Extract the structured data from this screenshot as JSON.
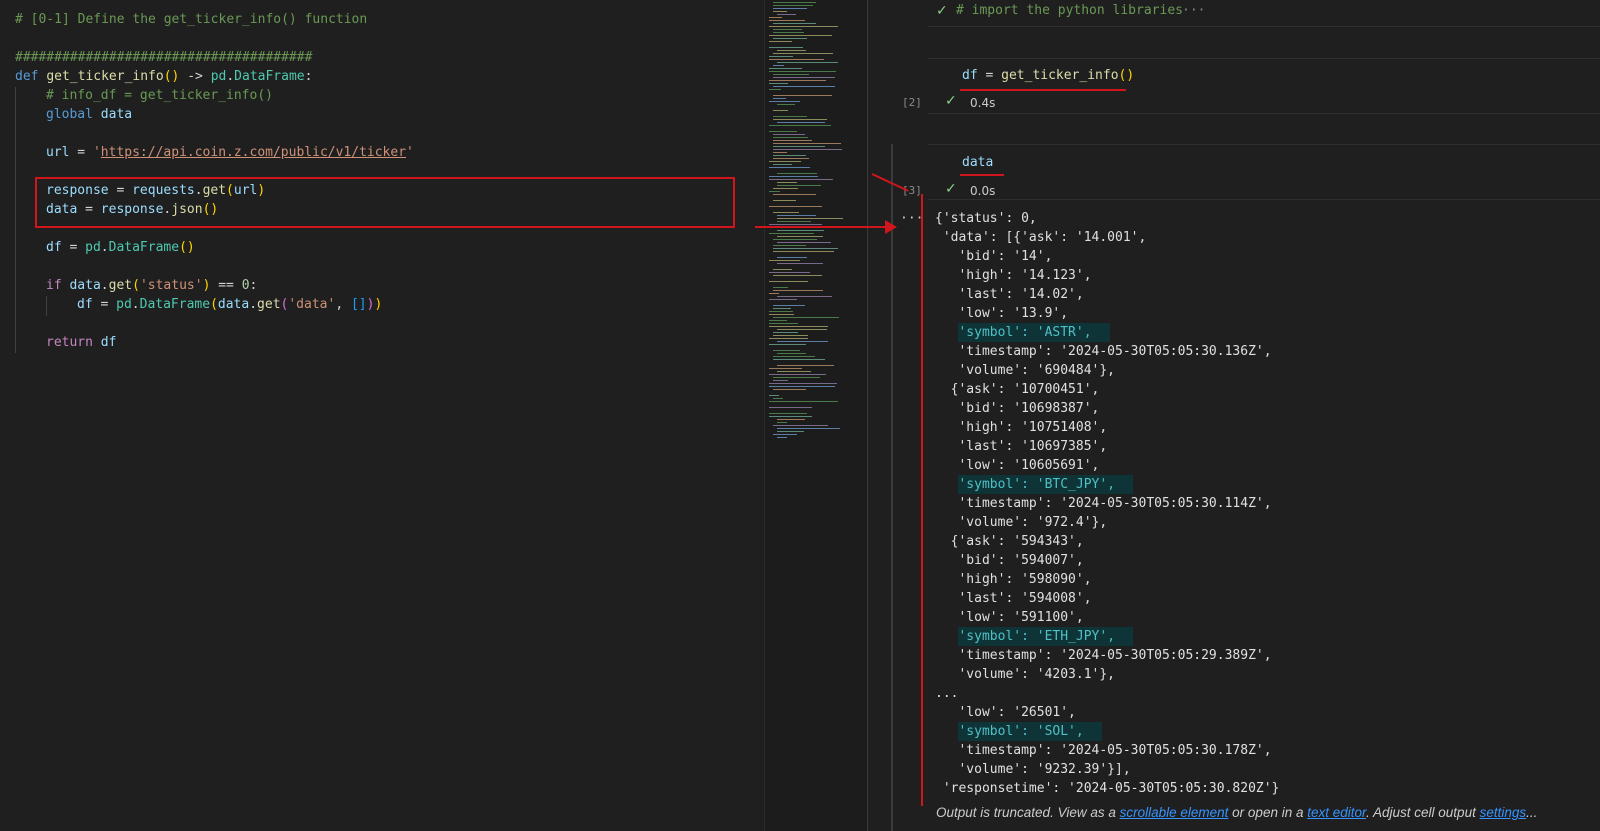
{
  "editor": {
    "comment_header": "# [0-1] Define the get_ticker_info() function",
    "hash_line": "######################################",
    "def_kw": "def",
    "func_name": "get_ticker_info",
    "arrow": " -> ",
    "ret_mod": "pd",
    "ret_cls": "DataFrame",
    "inner_comment": "# info_df = get_ticker_info()",
    "global_kw": "global",
    "global_var": "data",
    "url_var": "url",
    "url_value": "https://api.coin.z.com/public/v1/ticker",
    "response_var": "response",
    "requests_mod": "requests",
    "get_fn": "get",
    "url_arg": "url",
    "data_var": "data",
    "json_fn": "json",
    "df_var": "df",
    "pd_mod": "pd",
    "df_cls": "DataFrame",
    "if_kw": "if",
    "status_key": "'status'",
    "zero": "0",
    "data_key": "'data'",
    "return_kw": "return"
  },
  "notebook": {
    "cell1_text": "# import the python libraries",
    "cell1_more": "···",
    "cell2_code_var": "df",
    "cell2_code_fn": "get_ticker_info",
    "cell2_label": "[2]",
    "cell2_time": "0.4s",
    "cell3_code": "data",
    "cell3_label": "[3]",
    "cell3_time": "0.0s",
    "output_menu": "···",
    "output_lines": [
      "{'status': 0,",
      " 'data': [{'ask': '14.001',",
      "   'bid': '14',",
      "   'high': '14.123',",
      "   'last': '14.02',",
      "   'low': '13.9',",
      "   'symbol': 'ASTR',",
      "   'timestamp': '2024-05-30T05:05:30.136Z',",
      "   'volume': '690484'},",
      "  {'ask': '10700451',",
      "   'bid': '10698387',",
      "   'high': '10751408',",
      "   'last': '10697385',",
      "   'low': '10605691',",
      "   'symbol': 'BTC_JPY',",
      "   'timestamp': '2024-05-30T05:05:30.114Z',",
      "   'volume': '972.4'},",
      "  {'ask': '594343',",
      "   'bid': '594007',",
      "   'high': '598090',",
      "   'last': '594008',",
      "   'low': '591100',",
      "   'symbol': 'ETH_JPY',",
      "   'timestamp': '2024-05-30T05:05:29.389Z',",
      "   'volume': '4203.1'},",
      "...",
      "   'low': '26501',",
      "   'symbol': 'SOL',",
      "   'timestamp': '2024-05-30T05:05:30.178Z',",
      "   'volume': '9232.39'}],",
      " 'responsetime': '2024-05-30T05:05:30.820Z'}"
    ],
    "truncated": {
      "part1": "Output is truncated. View as a ",
      "link1": "scrollable element",
      "part2": " or open in a ",
      "link2": "text editor",
      "part3": ". Adjust cell output ",
      "link3": "settings",
      "part4": "..."
    }
  },
  "colors": {
    "annotation_red": "#d0161c",
    "highlight_bg": "#0f3437",
    "check_green": "#89d185"
  }
}
